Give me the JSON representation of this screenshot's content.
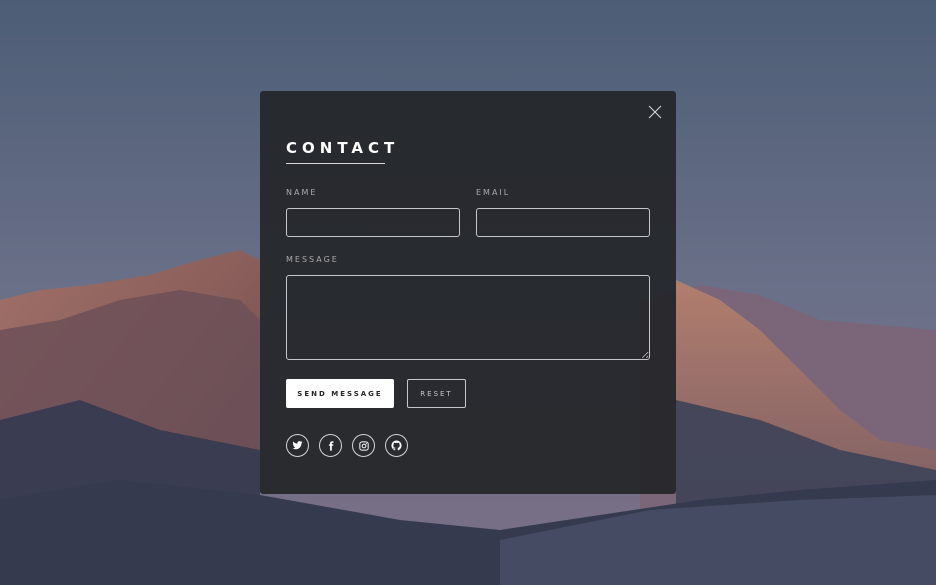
{
  "contact_form": {
    "title": "CONTACT",
    "fields": {
      "name_label": "NAME",
      "name_value": "",
      "email_label": "EMAIL",
      "email_value": "",
      "message_label": "MESSAGE",
      "message_value": ""
    },
    "buttons": {
      "send_label": "SEND MESSAGE",
      "reset_label": "RESET"
    },
    "social_icons": [
      "twitter-icon",
      "facebook-icon",
      "instagram-icon",
      "github-icon"
    ],
    "close_icon": "close-icon"
  },
  "colors": {
    "modal_background": "#242629",
    "text_primary": "#ffffff",
    "text_muted": "#a9abad",
    "border": "#c5c7c9"
  }
}
